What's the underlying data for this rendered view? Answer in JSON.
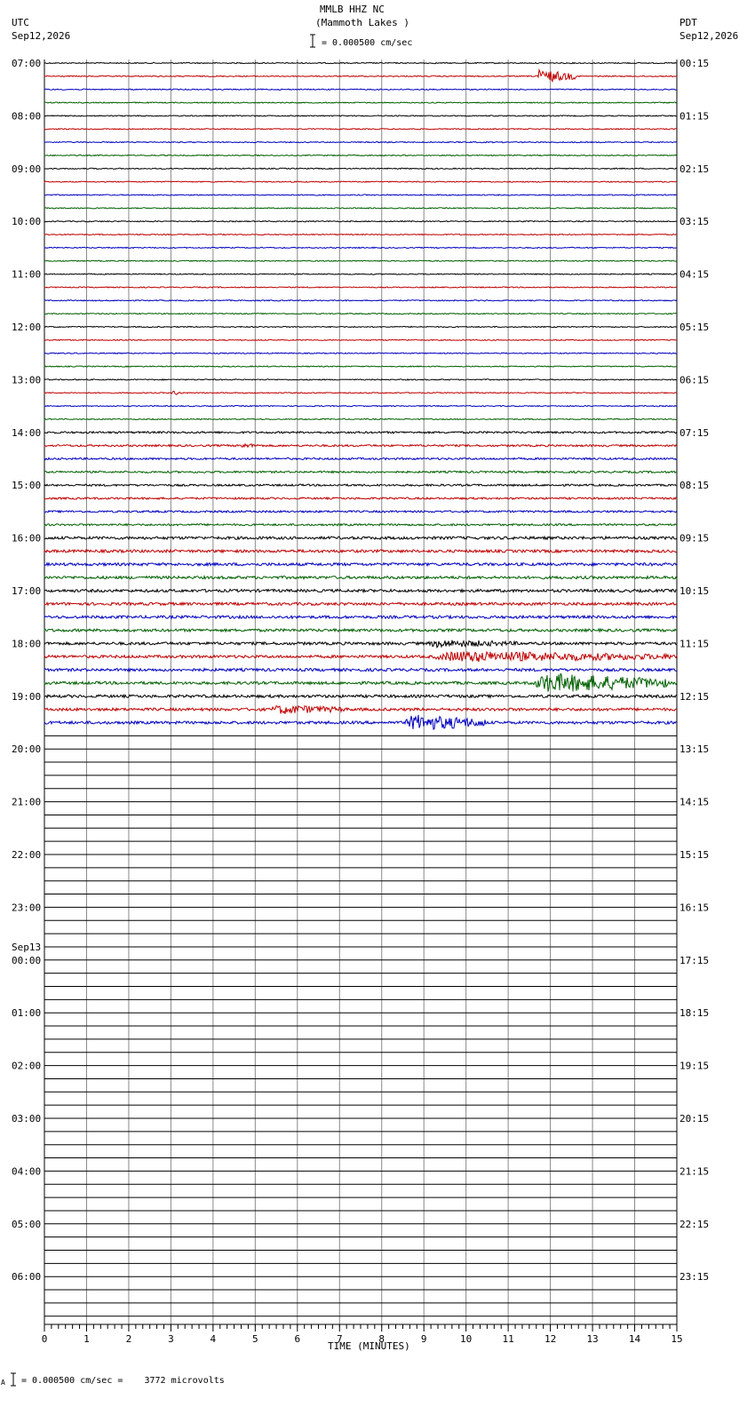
{
  "header": {
    "station": "MMLB HHZ NC",
    "location": "(Mammoth Lakes )",
    "scale": "= 0.000500 cm/sec",
    "left_tz": "UTC",
    "left_date": "Sep12,2026",
    "right_tz": "PDT",
    "right_date": "Sep12,2026"
  },
  "footer": {
    "calibration": "= 0.000500 cm/sec =    3772 microvolts",
    "marker": "A"
  },
  "chart_data": {
    "type": "line",
    "title": "MMLB HHZ NC (Mammoth Lakes )",
    "xlabel": "TIME (MINUTES)",
    "x_ticks": [
      "0",
      "1",
      "2",
      "3",
      "4",
      "5",
      "6",
      "7",
      "8",
      "9",
      "10",
      "11",
      "12",
      "13",
      "14",
      "15"
    ],
    "xlim": [
      0,
      15
    ],
    "grid": true,
    "trace_colors": [
      "#000000",
      "#c00000",
      "#0000c0",
      "#006000"
    ],
    "traces_per_hour": 4,
    "total_traces": 96,
    "recorded_traces": 51,
    "left_labels": [
      "07:00",
      "08:00",
      "09:00",
      "10:00",
      "11:00",
      "12:00",
      "13:00",
      "14:00",
      "15:00",
      "16:00",
      "17:00",
      "18:00",
      "19:00",
      "20:00",
      "21:00",
      "22:00",
      "23:00",
      "00:00",
      "01:00",
      "02:00",
      "03:00",
      "04:00",
      "05:00",
      "06:00"
    ],
    "date_change_label": "Sep13",
    "right_labels": [
      "00:15",
      "01:15",
      "02:15",
      "03:15",
      "04:15",
      "05:15",
      "06:15",
      "07:15",
      "08:15",
      "09:15",
      "10:15",
      "11:15",
      "12:15",
      "13:15",
      "14:15",
      "15:15",
      "16:15",
      "17:15",
      "18:15",
      "19:15",
      "20:15",
      "21:15",
      "22:15",
      "23:15"
    ],
    "events": [
      {
        "trace": 1,
        "start_min": 11.6,
        "end_min": 12.6,
        "amplitude": 8
      },
      {
        "trace": 25,
        "start_min": 3.0,
        "end_min": 3.3,
        "amplitude": 3
      },
      {
        "trace": 29,
        "start_min": 4.5,
        "end_min": 5.2,
        "amplitude": 3
      },
      {
        "trace": 44,
        "start_min": 9.0,
        "end_min": 11.3,
        "amplitude": 5
      },
      {
        "trace": 45,
        "start_min": 9.0,
        "end_min": 15.0,
        "amplitude": 7
      },
      {
        "trace": 47,
        "start_min": 11.5,
        "end_min": 14.8,
        "amplitude": 12
      },
      {
        "trace": 49,
        "start_min": 5.3,
        "end_min": 7.2,
        "amplitude": 6
      },
      {
        "trace": 50,
        "start_min": 8.5,
        "end_min": 10.5,
        "amplitude": 10
      }
    ]
  }
}
